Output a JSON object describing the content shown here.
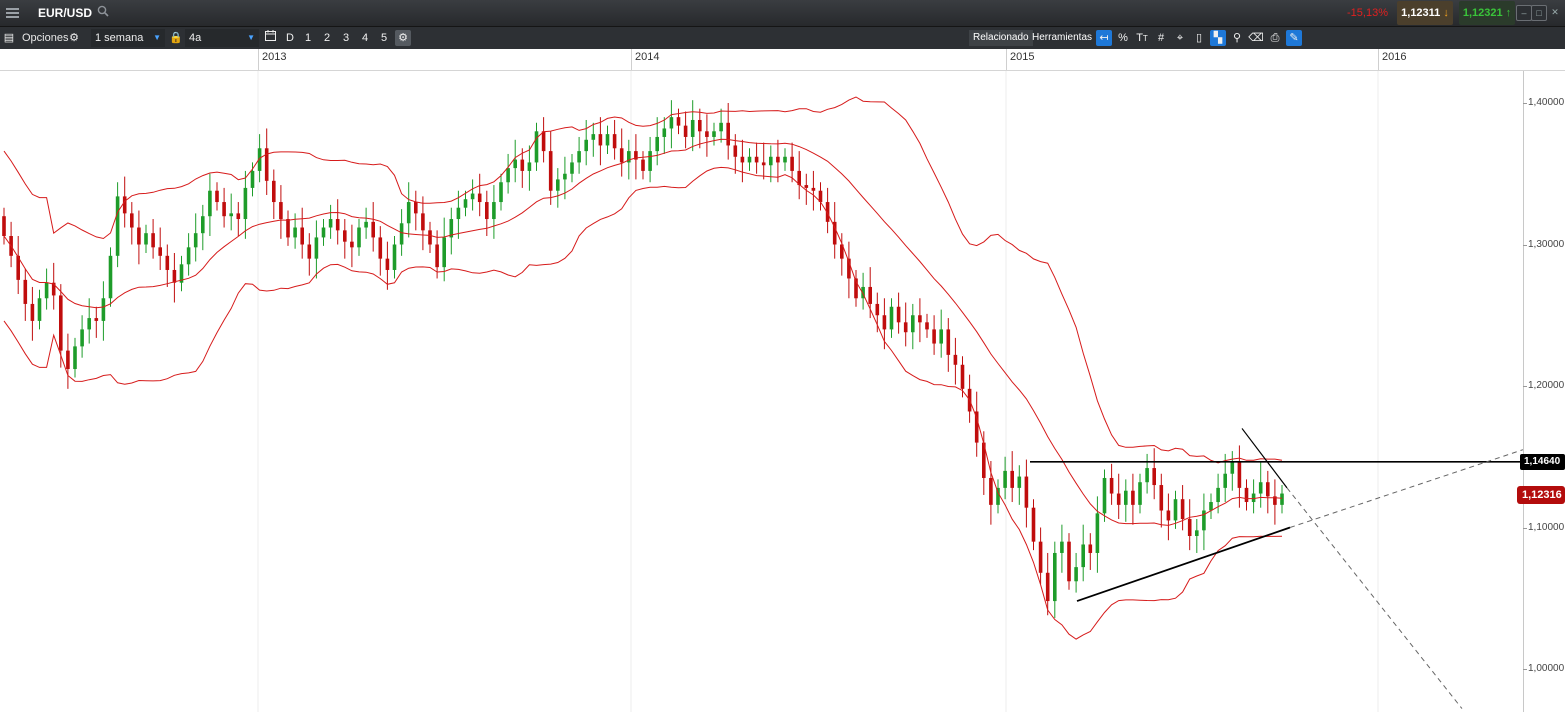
{
  "header": {
    "symbol": "EUR/USD",
    "change": "-15,13%",
    "bid": "1,12311",
    "ask": "1,12321"
  },
  "toolbar": {
    "options_label": "Opciones",
    "interval_value": "1 semana",
    "range_value": "4a",
    "d_label": "D",
    "period_buttons": [
      "1",
      "2",
      "3",
      "4",
      "5"
    ],
    "related_label": "Relacionado",
    "tools_label": "Herramientas",
    "percent_label": "%"
  },
  "timeline": {
    "years": [
      "2013",
      "2014",
      "2015",
      "2016"
    ]
  },
  "chart_data": {
    "type": "candlestick",
    "indicator": "Bollinger Bands",
    "colors": {
      "up": "#1e9c2a",
      "down": "#c00d0d",
      "bands": "#d61b1b"
    },
    "y_ticks": [
      "1,40000",
      "1,30000",
      "1,20000",
      "1,10000",
      "1,00000"
    ],
    "y_range": [
      0.975,
      1.425
    ],
    "x_range": [
      "2012-08",
      "2016-05"
    ],
    "resistance": "1,14640",
    "last_price": "1,12316",
    "candles": [
      [
        1.32,
        1.306
      ],
      [
        1.306,
        1.292
      ],
      [
        1.292,
        1.275
      ],
      [
        1.275,
        1.258
      ],
      [
        1.258,
        1.246
      ],
      [
        1.246,
        1.262
      ],
      [
        1.262,
        1.273
      ],
      [
        1.273,
        1.264
      ],
      [
        1.264,
        1.225
      ],
      [
        1.225,
        1.212
      ],
      [
        1.212,
        1.228
      ],
      [
        1.228,
        1.24
      ],
      [
        1.24,
        1.248
      ],
      [
        1.248,
        1.246
      ],
      [
        1.246,
        1.262
      ],
      [
        1.262,
        1.292
      ],
      [
        1.292,
        1.334
      ],
      [
        1.334,
        1.322
      ],
      [
        1.322,
        1.312
      ],
      [
        1.312,
        1.3
      ],
      [
        1.3,
        1.308
      ],
      [
        1.308,
        1.298
      ],
      [
        1.298,
        1.292
      ],
      [
        1.292,
        1.282
      ],
      [
        1.282,
        1.273
      ],
      [
        1.273,
        1.286
      ],
      [
        1.286,
        1.298
      ],
      [
        1.298,
        1.308
      ],
      [
        1.308,
        1.32
      ],
      [
        1.32,
        1.338
      ],
      [
        1.338,
        1.33
      ],
      [
        1.33,
        1.32
      ],
      [
        1.32,
        1.322
      ],
      [
        1.322,
        1.318
      ],
      [
        1.318,
        1.34
      ],
      [
        1.34,
        1.352
      ],
      [
        1.352,
        1.368
      ],
      [
        1.368,
        1.345
      ],
      [
        1.345,
        1.33
      ],
      [
        1.33,
        1.318
      ],
      [
        1.318,
        1.305
      ],
      [
        1.305,
        1.312
      ],
      [
        1.312,
        1.3
      ],
      [
        1.3,
        1.29
      ],
      [
        1.29,
        1.305
      ],
      [
        1.305,
        1.312
      ],
      [
        1.312,
        1.318
      ],
      [
        1.318,
        1.31
      ],
      [
        1.31,
        1.302
      ],
      [
        1.302,
        1.298
      ],
      [
        1.298,
        1.312
      ],
      [
        1.312,
        1.316
      ],
      [
        1.316,
        1.305
      ],
      [
        1.305,
        1.29
      ],
      [
        1.29,
        1.282
      ],
      [
        1.282,
        1.3
      ],
      [
        1.3,
        1.315
      ],
      [
        1.315,
        1.33
      ],
      [
        1.33,
        1.322
      ],
      [
        1.322,
        1.31
      ],
      [
        1.31,
        1.3
      ],
      [
        1.3,
        1.284
      ],
      [
        1.284,
        1.305
      ],
      [
        1.305,
        1.318
      ],
      [
        1.318,
        1.326
      ],
      [
        1.326,
        1.332
      ],
      [
        1.332,
        1.336
      ],
      [
        1.336,
        1.33
      ],
      [
        1.33,
        1.318
      ],
      [
        1.318,
        1.33
      ],
      [
        1.33,
        1.344
      ],
      [
        1.344,
        1.354
      ],
      [
        1.354,
        1.36
      ],
      [
        1.36,
        1.352
      ],
      [
        1.352,
        1.358
      ],
      [
        1.358,
        1.38
      ],
      [
        1.38,
        1.366
      ],
      [
        1.366,
        1.338
      ],
      [
        1.338,
        1.346
      ],
      [
        1.346,
        1.35
      ],
      [
        1.35,
        1.358
      ],
      [
        1.358,
        1.366
      ],
      [
        1.366,
        1.374
      ],
      [
        1.374,
        1.378
      ],
      [
        1.378,
        1.37
      ],
      [
        1.37,
        1.378
      ],
      [
        1.378,
        1.368
      ],
      [
        1.368,
        1.358
      ],
      [
        1.358,
        1.366
      ],
      [
        1.366,
        1.36
      ],
      [
        1.36,
        1.352
      ],
      [
        1.352,
        1.366
      ],
      [
        1.366,
        1.376
      ],
      [
        1.376,
        1.382
      ],
      [
        1.382,
        1.39
      ],
      [
        1.39,
        1.384
      ],
      [
        1.384,
        1.376
      ],
      [
        1.376,
        1.388
      ],
      [
        1.388,
        1.38
      ],
      [
        1.38,
        1.376
      ],
      [
        1.376,
        1.38
      ],
      [
        1.38,
        1.386
      ],
      [
        1.386,
        1.37
      ],
      [
        1.37,
        1.362
      ],
      [
        1.362,
        1.358
      ],
      [
        1.358,
        1.362
      ],
      [
        1.362,
        1.358
      ],
      [
        1.358,
        1.356
      ],
      [
        1.356,
        1.362
      ],
      [
        1.362,
        1.358
      ],
      [
        1.358,
        1.362
      ],
      [
        1.362,
        1.352
      ],
      [
        1.352,
        1.342
      ],
      [
        1.342,
        1.34
      ],
      [
        1.34,
        1.338
      ],
      [
        1.338,
        1.33
      ],
      [
        1.33,
        1.316
      ],
      [
        1.316,
        1.3
      ],
      [
        1.3,
        1.29
      ],
      [
        1.29,
        1.276
      ],
      [
        1.276,
        1.262
      ],
      [
        1.262,
        1.27
      ],
      [
        1.27,
        1.258
      ],
      [
        1.258,
        1.25
      ],
      [
        1.25,
        1.24
      ],
      [
        1.24,
        1.256
      ],
      [
        1.256,
        1.245
      ],
      [
        1.245,
        1.238
      ],
      [
        1.238,
        1.25
      ],
      [
        1.25,
        1.245
      ],
      [
        1.245,
        1.24
      ],
      [
        1.24,
        1.23
      ],
      [
        1.23,
        1.24
      ],
      [
        1.24,
        1.222
      ],
      [
        1.222,
        1.215
      ],
      [
        1.215,
        1.198
      ],
      [
        1.198,
        1.182
      ],
      [
        1.182,
        1.16
      ],
      [
        1.16,
        1.135
      ],
      [
        1.135,
        1.116
      ],
      [
        1.116,
        1.128
      ],
      [
        1.128,
        1.14
      ],
      [
        1.14,
        1.128
      ],
      [
        1.128,
        1.136
      ],
      [
        1.136,
        1.114
      ],
      [
        1.114,
        1.09
      ],
      [
        1.09,
        1.068
      ],
      [
        1.068,
        1.048
      ],
      [
        1.048,
        1.082
      ],
      [
        1.082,
        1.09
      ],
      [
        1.09,
        1.062
      ],
      [
        1.062,
        1.072
      ],
      [
        1.072,
        1.088
      ],
      [
        1.088,
        1.082
      ],
      [
        1.082,
        1.11
      ],
      [
        1.11,
        1.135
      ],
      [
        1.135,
        1.124
      ],
      [
        1.124,
        1.116
      ],
      [
        1.116,
        1.126
      ],
      [
        1.126,
        1.116
      ],
      [
        1.116,
        1.132
      ],
      [
        1.132,
        1.142
      ],
      [
        1.142,
        1.13
      ],
      [
        1.13,
        1.112
      ],
      [
        1.112,
        1.105
      ],
      [
        1.105,
        1.12
      ],
      [
        1.12,
        1.106
      ],
      [
        1.106,
        1.094
      ],
      [
        1.094,
        1.098
      ],
      [
        1.098,
        1.112
      ],
      [
        1.112,
        1.118
      ],
      [
        1.118,
        1.128
      ],
      [
        1.128,
        1.138
      ],
      [
        1.138,
        1.146
      ],
      [
        1.146,
        1.128
      ],
      [
        1.128,
        1.118
      ],
      [
        1.118,
        1.124
      ],
      [
        1.124,
        1.132
      ],
      [
        1.132,
        1.122
      ],
      [
        1.122,
        1.116
      ],
      [
        1.116,
        1.124
      ]
    ]
  }
}
